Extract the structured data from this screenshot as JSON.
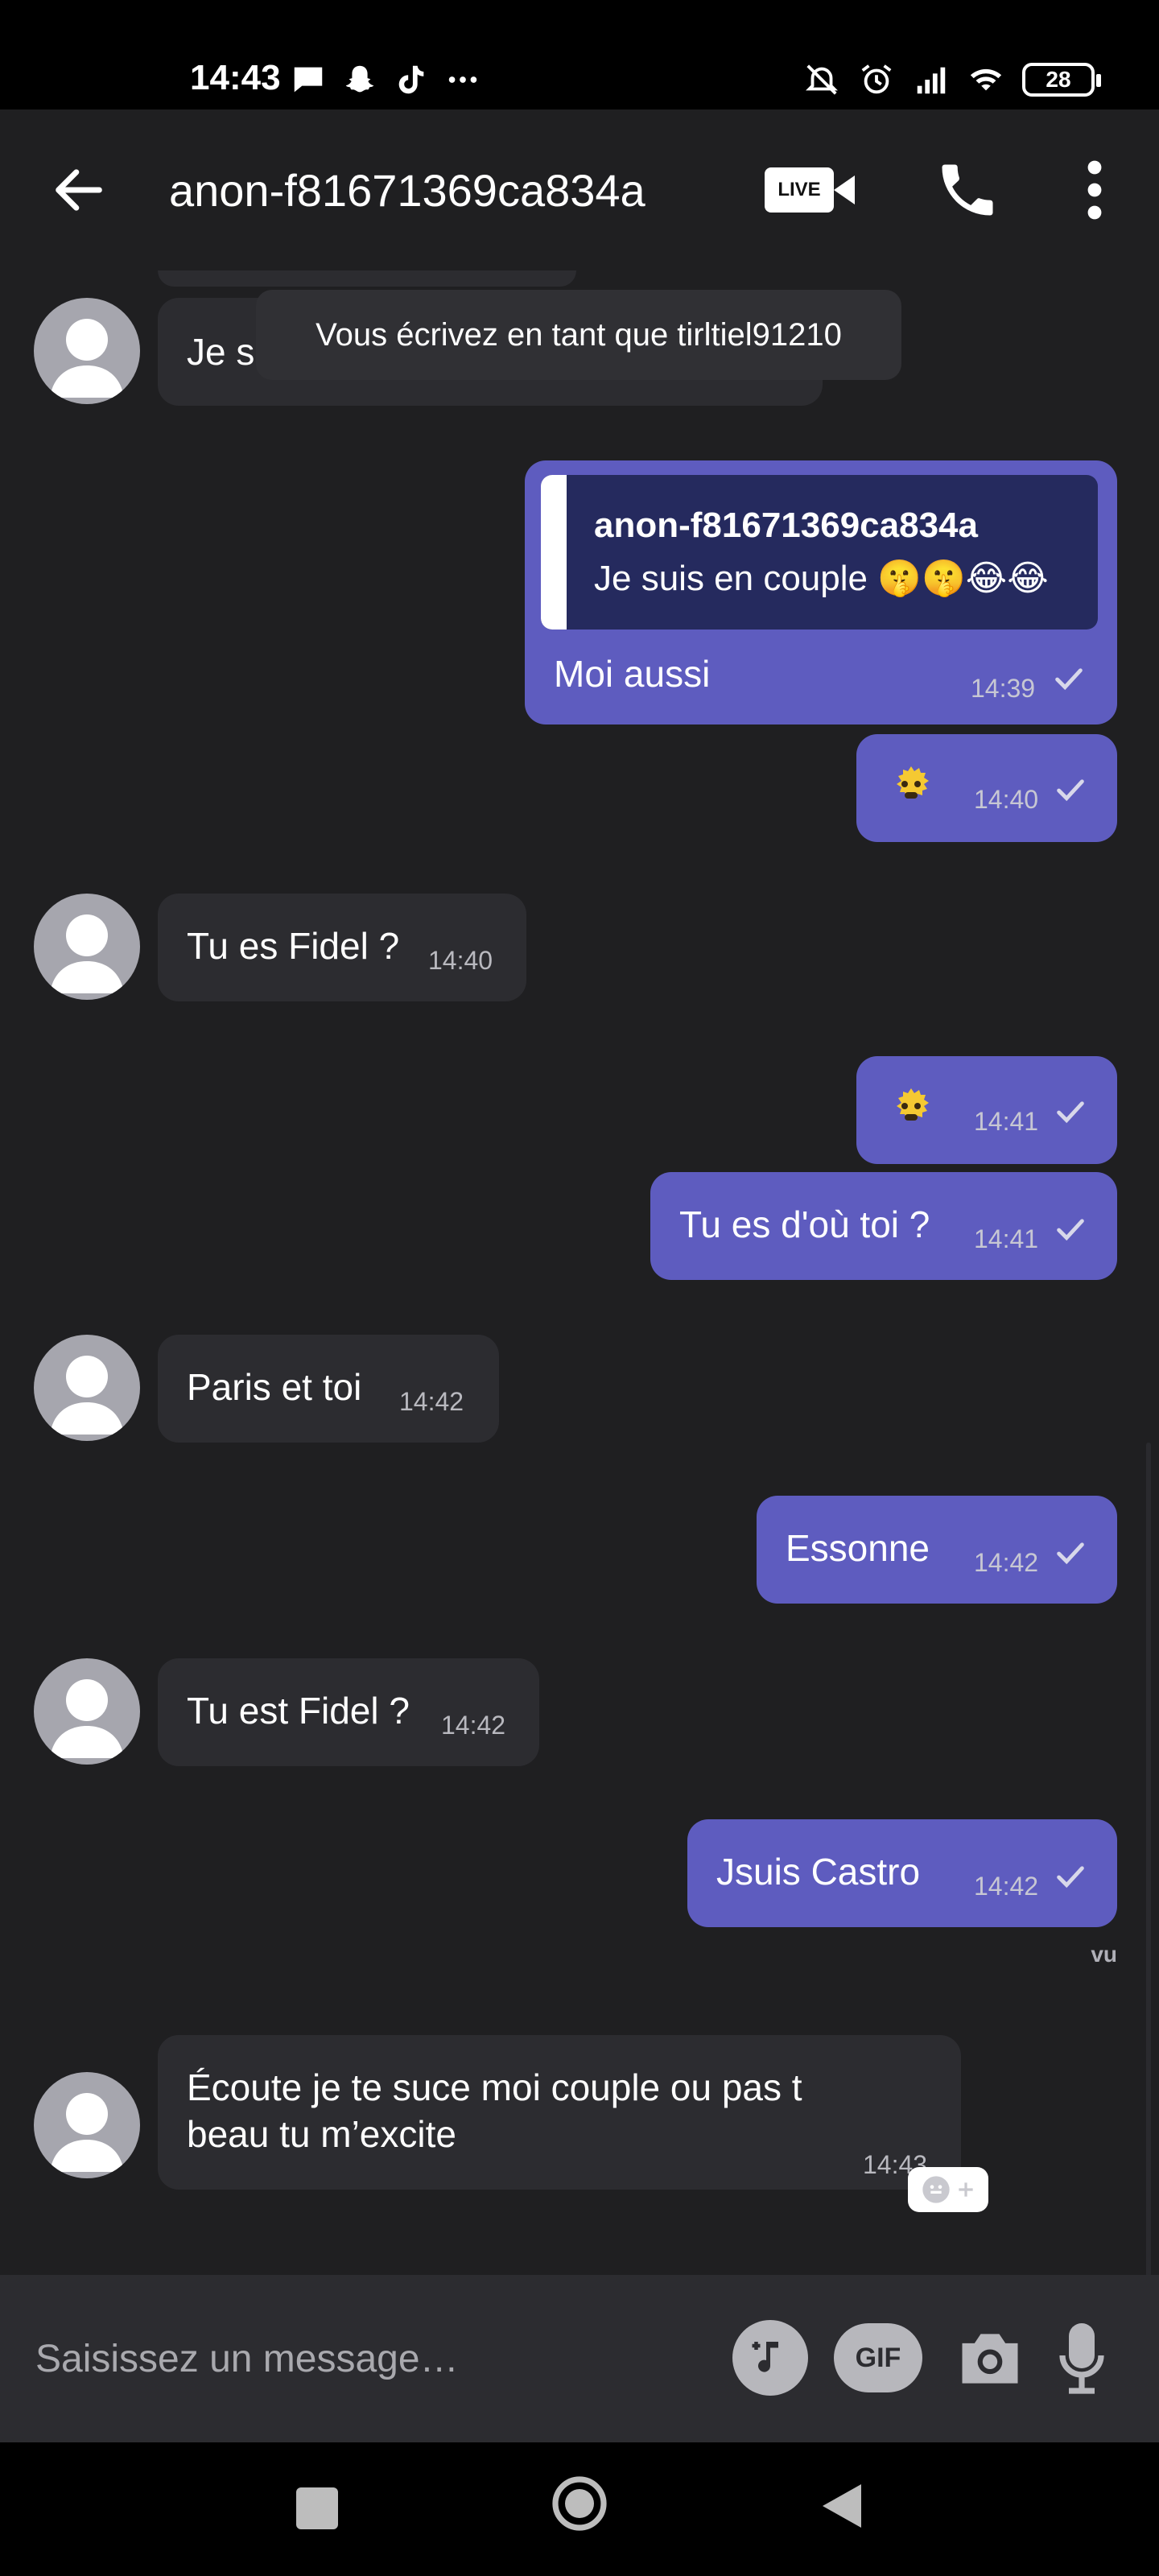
{
  "status_bar": {
    "time": "14:43",
    "battery": "28",
    "left_icons": [
      "message-icon",
      "snapchat-icon",
      "tiktok-icon",
      "more-dots-icon"
    ],
    "right_icons": [
      "muted-icon",
      "alarm-icon",
      "signal-icon",
      "wifi-icon",
      "battery-icon"
    ]
  },
  "header": {
    "title": "anon-f81671369ca834a",
    "live_label": "LIVE"
  },
  "toast": {
    "text": "Vous écrivez en tant que tirltiel91210"
  },
  "messages": {
    "m0": {
      "direction": "in",
      "text": "Je s"
    },
    "m1": {
      "direction": "out",
      "quote_author": "anon-f81671369ca834a",
      "quote_text": "Je suis en couple 🤫🤫😂😂",
      "text": "Moi aussi",
      "time": "14:39"
    },
    "m2": {
      "direction": "out",
      "sticker": "🫨",
      "time": "14:40"
    },
    "m3": {
      "direction": "in",
      "text": "Tu es Fidel ?",
      "time": "14:40"
    },
    "m4": {
      "direction": "out",
      "sticker": "🫨",
      "time": "14:41"
    },
    "m5": {
      "direction": "out",
      "text": "Tu es d'où toi ?",
      "time": "14:41"
    },
    "m6": {
      "direction": "in",
      "text": "Paris et toi",
      "time": "14:42"
    },
    "m7": {
      "direction": "out",
      "text": "Essonne",
      "time": "14:42"
    },
    "m8": {
      "direction": "in",
      "text": "Tu est Fidel ?",
      "time": "14:42"
    },
    "m9": {
      "direction": "out",
      "text": "Jsuis Castro",
      "time": "14:42"
    },
    "m10": {
      "direction": "in",
      "line1": "Écoute je te suce moi couple ou pas t",
      "line2": "beau tu m’excite",
      "time": "14:43"
    }
  },
  "seen_label": "vu",
  "composer": {
    "placeholder": "Saisissez un message…",
    "gif_label": "GIF"
  },
  "colors": {
    "background": "#1f1f21",
    "outgoing_bubble": "#5e5cbf",
    "incoming_bubble": "#2c2c30",
    "quote_background": "#252a5e"
  }
}
